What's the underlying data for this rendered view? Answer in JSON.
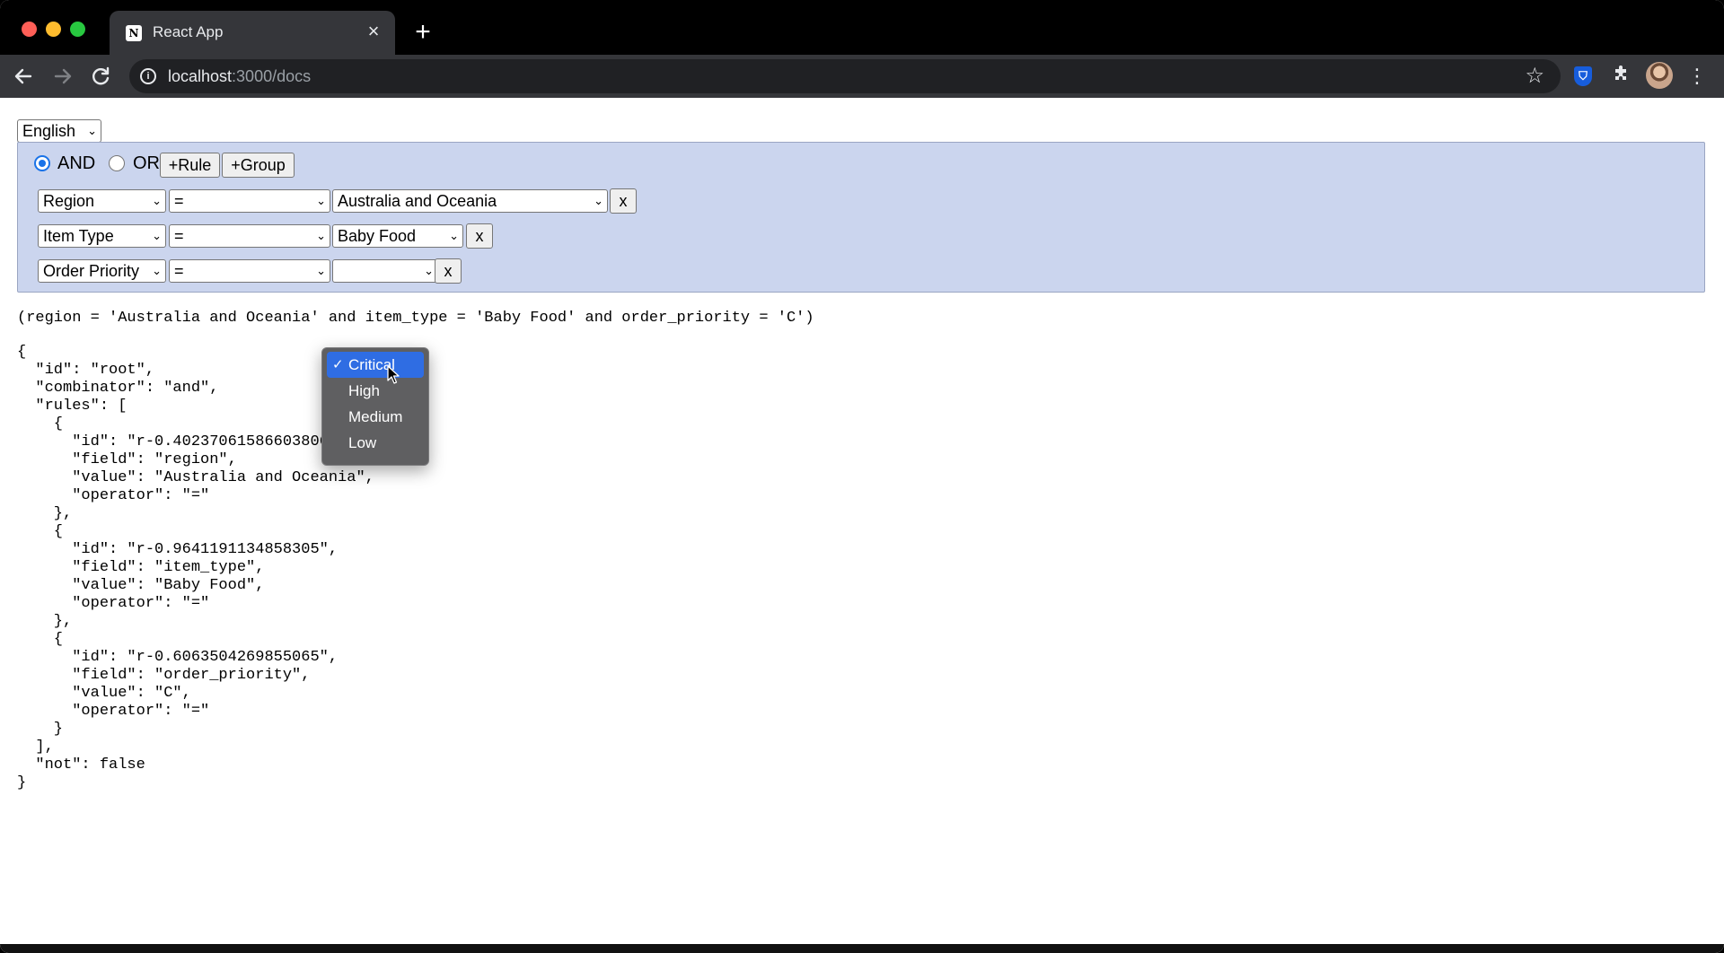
{
  "browser": {
    "tab_title": "React App",
    "tab_favicon": "N",
    "tab_close": "×",
    "new_tab": "+",
    "url_host": "localhost",
    "url_rest": ":3000/docs",
    "icons": {
      "back": "back-arrow-icon",
      "forward": "forward-arrow-icon",
      "reload": "reload-icon",
      "info": "info-icon",
      "star": "star-icon",
      "bitwarden": "bitwarden-icon",
      "extensions": "puzzle-icon",
      "menu": "kebab-menu-icon"
    }
  },
  "language_select": {
    "value": "English"
  },
  "query_builder": {
    "combinators": {
      "and_label": "AND",
      "or_label": "OR",
      "selected": "and"
    },
    "add_rule_label": "+Rule",
    "add_group_label": "+Group",
    "rules": [
      {
        "field": "Region",
        "operator": "=",
        "value": "Australia and Oceania",
        "remove": "x"
      },
      {
        "field": "Item Type",
        "operator": "=",
        "value": "Baby Food",
        "remove": "x"
      },
      {
        "field": "Order Priority",
        "operator": "=",
        "value": "",
        "remove": "x"
      }
    ]
  },
  "dropdown": {
    "options": [
      {
        "label": "Critical",
        "selected": true,
        "check": "✓"
      },
      {
        "label": "High",
        "selected": false
      },
      {
        "label": "Medium",
        "selected": false
      },
      {
        "label": "Low",
        "selected": false
      }
    ]
  },
  "sql_output": "(region = 'Australia and Oceania' and item_type = 'Baby Food' and order_priority = 'C')",
  "json_output": [
    "{",
    "  \"id\": \"root\",",
    "  \"combinator\": \"and\",",
    "  \"rules\": [",
    "    {",
    "      \"id\": \"r-0.40237061586603806\",",
    "      \"field\": \"region\",",
    "      \"value\": \"Australia and Oceania\",",
    "      \"operator\": \"=\"",
    "    },",
    "    {",
    "      \"id\": \"r-0.9641191134858305\",",
    "      \"field\": \"item_type\",",
    "      \"value\": \"Baby Food\",",
    "      \"operator\": \"=\"",
    "    },",
    "    {",
    "      \"id\": \"r-0.6063504269855065\",",
    "      \"field\": \"order_priority\",",
    "      \"value\": \"C\",",
    "      \"operator\": \"=\"",
    "    }",
    "  ],",
    "  \"not\": false",
    "}"
  ],
  "colors": {
    "panel_bg": "#cbd5ee",
    "selected_option": "#2f6de3",
    "radio_accent": "#1a73e8"
  }
}
